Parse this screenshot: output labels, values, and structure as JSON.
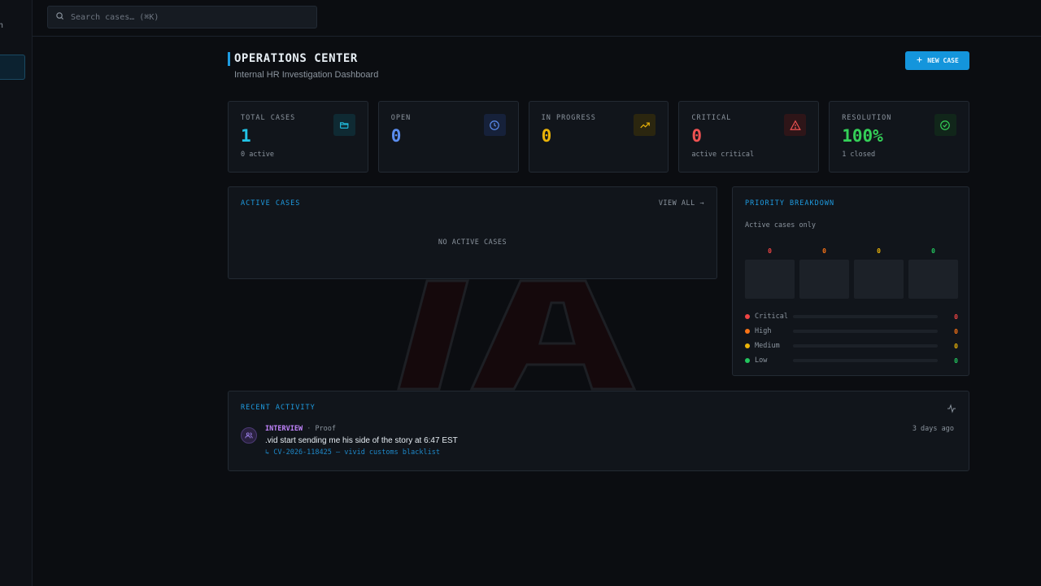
{
  "sidebar": {
    "fragment_text": "n"
  },
  "search": {
    "placeholder": "Search cases… (⌘K)"
  },
  "header": {
    "title": "OPERATIONS CENTER",
    "subtitle": "Internal HR Investigation Dashboard",
    "new_case_label": "NEW CASE",
    "accent": "#1e9be0"
  },
  "stats": [
    {
      "label": "TOTAL CASES",
      "value": "1",
      "sub": "0 active",
      "color": "#22c3e6",
      "icon": "folder-open-icon"
    },
    {
      "label": "OPEN",
      "value": "0",
      "sub": "",
      "color": "#5b8def",
      "icon": "clock-icon"
    },
    {
      "label": "IN PROGRESS",
      "value": "0",
      "sub": "",
      "color": "#eab308",
      "icon": "trending-up-icon"
    },
    {
      "label": "CRITICAL",
      "value": "0",
      "sub": "active critical",
      "color": "#f05252",
      "icon": "warning-icon"
    },
    {
      "label": "RESOLUTION",
      "value": "100%",
      "sub": "1 closed",
      "color": "#34d058",
      "icon": "check-circle-icon"
    }
  ],
  "active_cases": {
    "title": "ACTIVE CASES",
    "view_all": "VIEW ALL →",
    "empty": "NO ACTIVE CASES"
  },
  "priority": {
    "title": "PRIORITY BREAKDOWN",
    "subtitle": "Active cases only",
    "levels": [
      {
        "name": "Critical",
        "count": "0",
        "color": "#ef4444"
      },
      {
        "name": "High",
        "count": "0",
        "color": "#f97316"
      },
      {
        "name": "Medium",
        "count": "0",
        "color": "#eab308"
      },
      {
        "name": "Low",
        "count": "0",
        "color": "#22c55e"
      }
    ]
  },
  "recent": {
    "title": "RECENT ACTIVITY",
    "items": [
      {
        "type": "INTERVIEW",
        "separator": "·",
        "author": "Proof",
        "message": ".vid start sending me his side of the story at 6:47 EST",
        "link": "↳ CV-2026-118425 — vivid customs blacklist",
        "time": "3 days ago"
      }
    ]
  },
  "watermark": {
    "text": "IA"
  }
}
